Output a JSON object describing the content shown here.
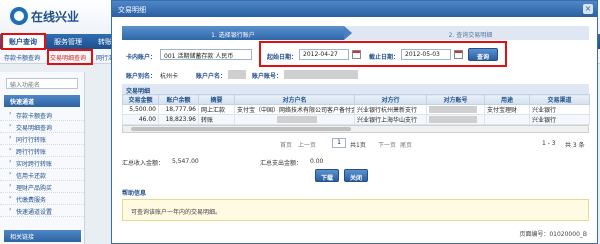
{
  "background": {
    "logo_text": "在线兴业",
    "nav_items": [
      "账户查询",
      "服务管理",
      "转账"
    ],
    "subnav_items": [
      "存款卡额查询",
      "交易明细查询",
      "网行汇"
    ],
    "sidebar": {
      "search_placeholder": "输入功能名",
      "section_title": "快速通道",
      "items": [
        "存款卡额查询",
        "交易明细查询",
        "同行行转账",
        "跨行行转账",
        "实时跨行转账",
        "信用卡还款",
        "理财产品购买",
        "代缴费服务",
        "快速通道设置"
      ],
      "footer": "相关链接"
    }
  },
  "dialog": {
    "title": "交易明细",
    "close_icon": "×",
    "steps": [
      "1. 选择银行账户",
      "2. 查询交易明细"
    ],
    "account_label": "卡内账户：",
    "account_value": "001 活期储蓄存款 人民币",
    "start_label": "起始日期：",
    "start_value": "2012-04-27",
    "end_label": "截止日期：",
    "end_value": "2012-05-03",
    "query_button": "查询",
    "alias_label": "账户别名：",
    "alias_value": "杭州卡",
    "holder_label": "账户户名：",
    "number_label": "账户账号：",
    "section_title": "交易明细",
    "table": {
      "headers": [
        "交易金额",
        "账户余额",
        "摘要",
        "对方户名",
        "对方行",
        "对方账号",
        "用途",
        "交易渠道"
      ],
      "rows": [
        [
          "5,500.00",
          "18,777.96",
          "网上汇款",
          "支付宝（中国）网络技术有限公司客户备付金",
          "兴业银行杭州萧新支行",
          "",
          "支付宝理财",
          "兴业银行"
        ],
        [
          "46.00",
          "18,823.96",
          "转账",
          "",
          "兴业银行上海华山支行",
          "",
          "",
          "兴业银行"
        ]
      ]
    },
    "pager": {
      "first": "首页",
      "prev": "上一页",
      "page_value": "1",
      "page_total": "共1页",
      "next": "下一页",
      "last": "尾页",
      "range": "1 - 3",
      "count": "共 3 条"
    },
    "summary_in_label": "汇总收入金额：",
    "summary_in_value": "5,547.00",
    "summary_out_label": "汇总支出金额：",
    "summary_out_value": "0.00",
    "download_button": "下载",
    "close_button": "关闭",
    "help_title": "帮助信息",
    "help_text": "可查询该账户一年内的交易明细。",
    "page_no_label": "页面编号：",
    "page_no_value": "01020000_B"
  }
}
